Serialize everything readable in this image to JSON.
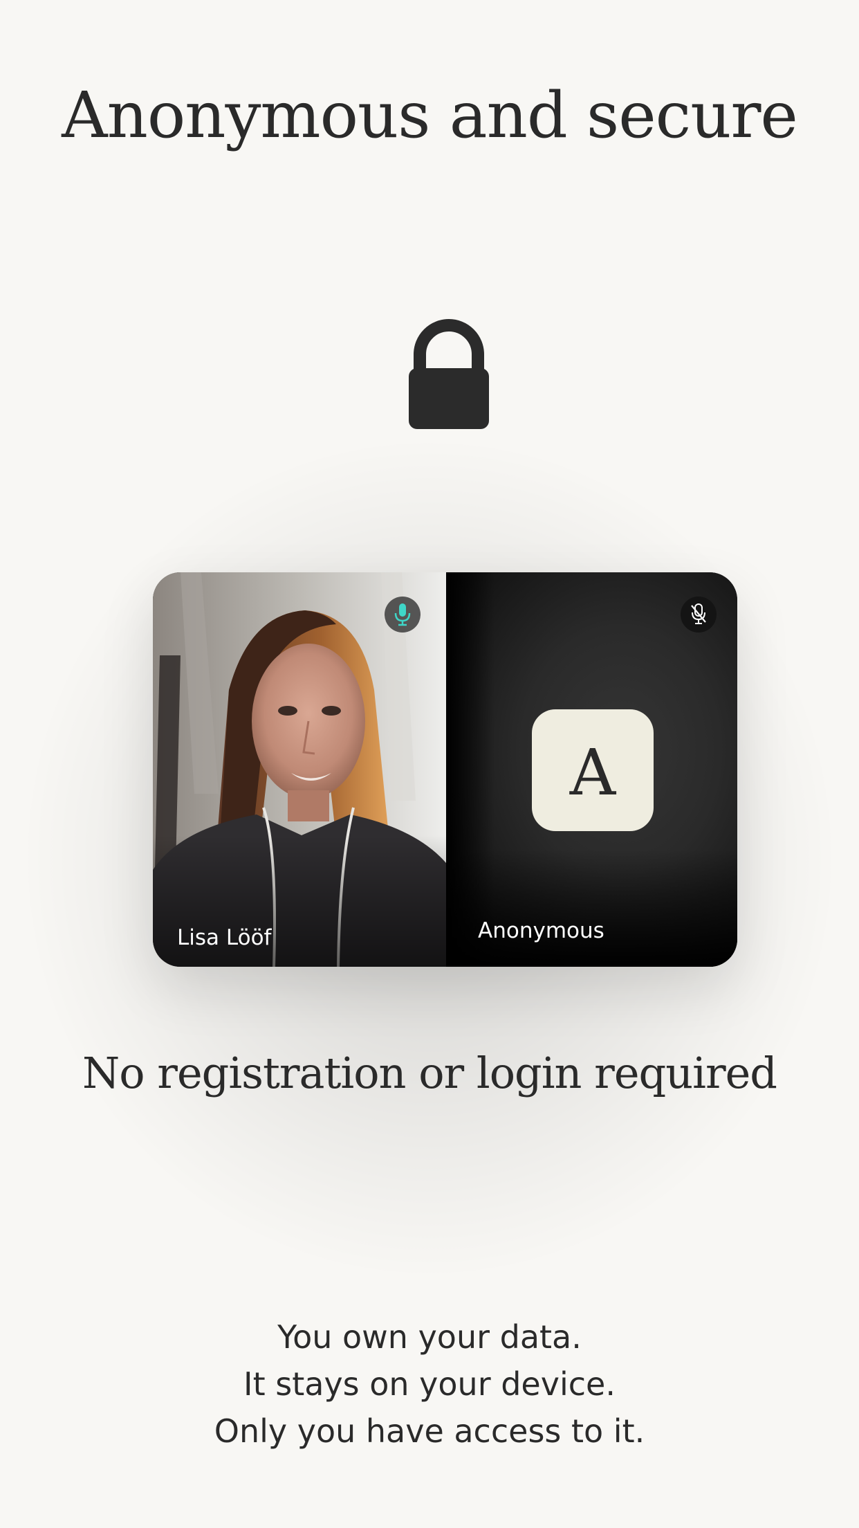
{
  "title": "Anonymous and secure",
  "call": {
    "participant_left_name": "Lisa Lööf",
    "participant_right_name": "Anonymous",
    "avatar_letter": "A",
    "left_mic": "mic-on-icon",
    "right_mic": "mic-muted-icon"
  },
  "subtitle": "No registration or login required",
  "body_lines": [
    "You own your data.",
    "It stays on your device.",
    "Only you have access to it."
  ],
  "colors": {
    "background": "#f8f7f4",
    "text": "#2a2a2a",
    "avatar_bg": "#efede0",
    "mic_active": "#3fd6c8"
  }
}
